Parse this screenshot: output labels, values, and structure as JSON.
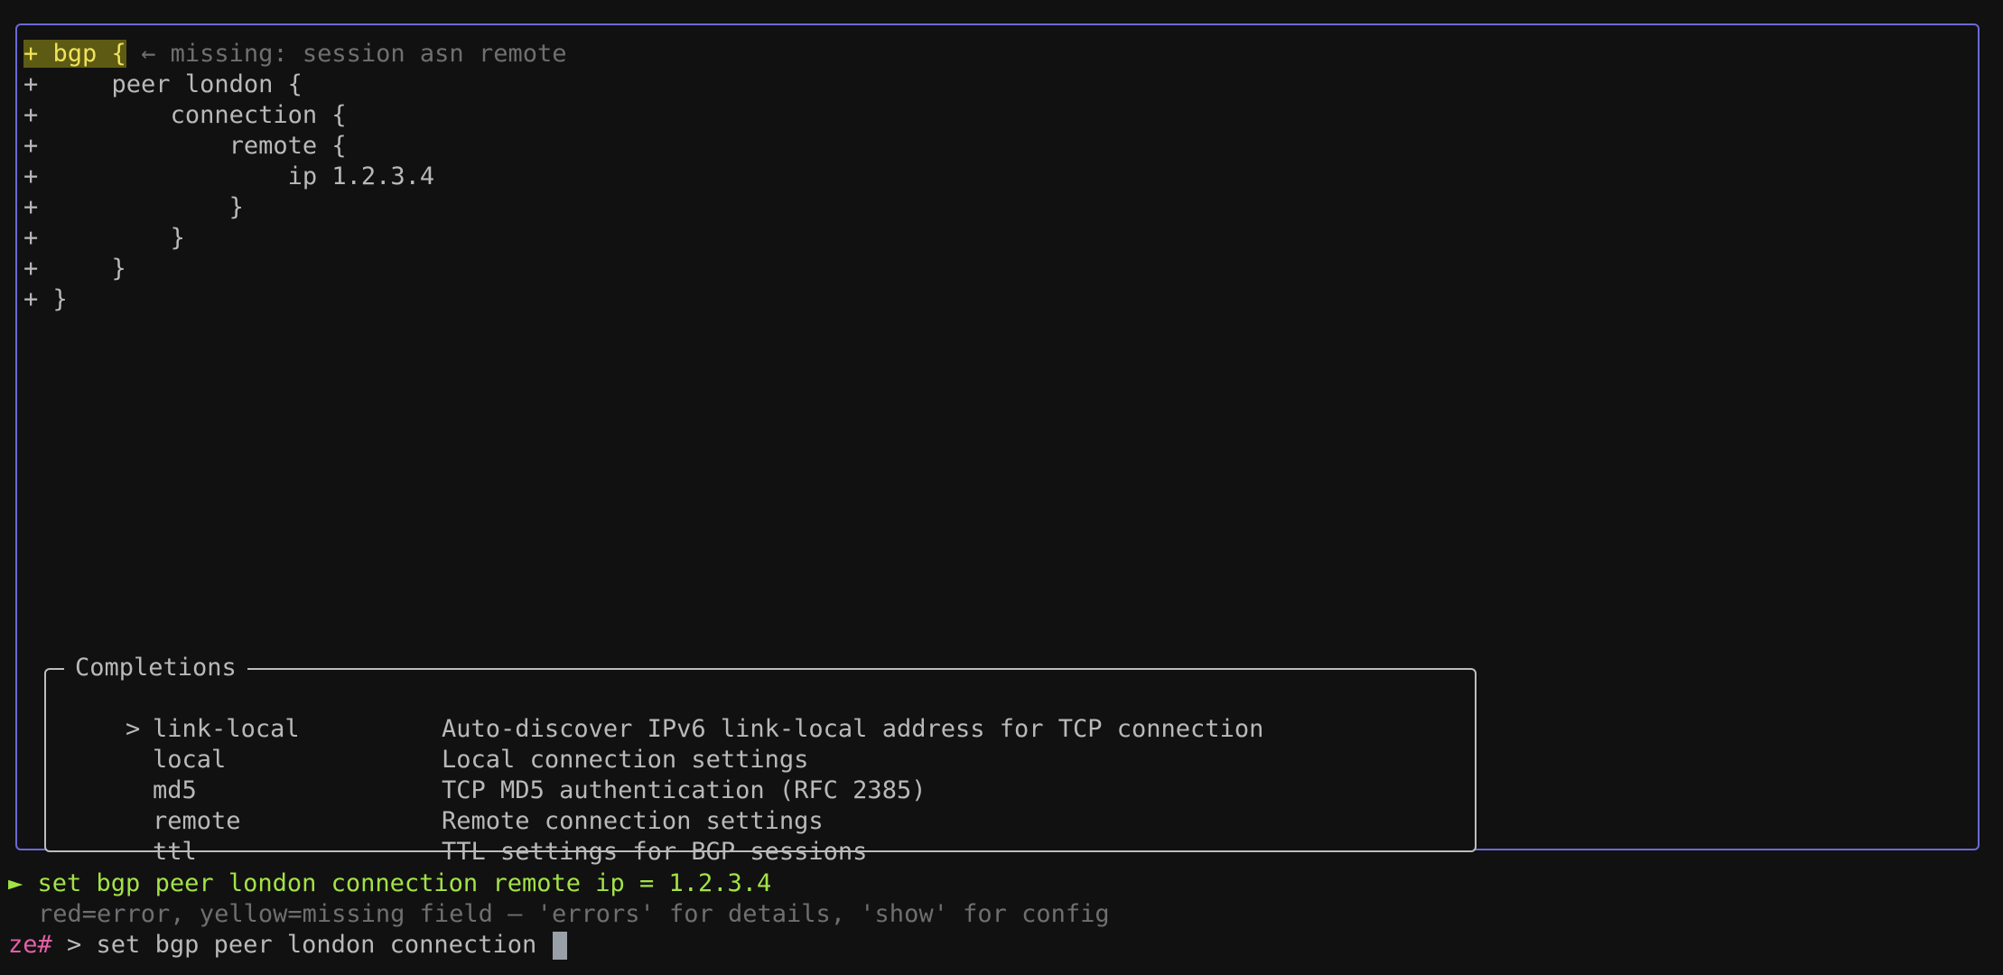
{
  "config": {
    "lines": [
      {
        "marker": "+",
        "text": " bgp {",
        "hint": " ← missing: session asn remote"
      },
      {
        "marker": "+",
        "text": "     peer london {"
      },
      {
        "marker": "+",
        "text": "         connection {"
      },
      {
        "marker": "+",
        "text": "             remote {"
      },
      {
        "marker": "+",
        "text": "                 ip 1.2.3.4"
      },
      {
        "marker": "+",
        "text": "             }"
      },
      {
        "marker": "+",
        "text": "         }"
      },
      {
        "marker": "+",
        "text": "     }"
      },
      {
        "marker": "+",
        "text": " }"
      }
    ]
  },
  "completions": {
    "title": "Completions",
    "selected_marker": ">",
    "items": [
      {
        "name": "link-local",
        "description": "Auto-discover IPv6 link-local address for TCP connection"
      },
      {
        "name": "local",
        "description": "Local connection settings"
      },
      {
        "name": "md5",
        "description": "TCP MD5 authentication (RFC 2385)"
      },
      {
        "name": "remote",
        "description": "Remote connection settings"
      },
      {
        "name": "ttl",
        "description": "TTL settings for BGP sessions"
      }
    ]
  },
  "status": {
    "result_marker": "►",
    "result_text": " set bgp peer london connection remote ip = 1.2.3.4",
    "help_text": "red=error, yellow=missing field — 'errors' for details, 'show' for config"
  },
  "prompt": {
    "label": "ze#",
    "input_value": " > set bgp peer london connection "
  },
  "colors": {
    "pane_border": "#6b69d6",
    "highlight_bg": "#5d5a14",
    "highlight_fg": "#f0e35a",
    "success": "#a3e246",
    "prompt": "#e55fa6"
  }
}
